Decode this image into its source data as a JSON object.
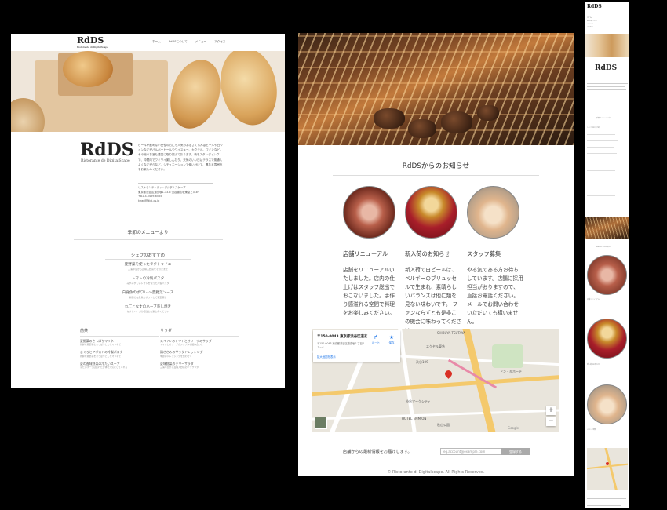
{
  "desktop": {
    "logo": "RdDS",
    "logo_sub": "Ristorante di DigitalScape",
    "nav": [
      "ホーム",
      "RdDSについて",
      "メニュー",
      "アクセス"
    ],
    "brand": "RdDS",
    "brand_sub": "Ristorante de DigitalScape",
    "intro": "ビールが飲めない女性の方にも人気のあるさくらんぼビールや白ワインなどがバルポーピールやワイスキー、カクテル、ワインなど、その他のお酒も豊富に取り揃えております。夜もスタンディングで、仲間内でワイワイ楽しんだり、天気のいい日はテラスで風通しよくなどがらなど、シチュエーションで使い分けて、異なる雰囲気をお楽しみください。",
    "address": [
      "リストランテ・ディ・デジタルスケープ",
      "東京都渋谷区道玄坂1-13-6 渋谷道玄坂東急ビル3F",
      "+81-3-5459-6535",
      "kirari@digi-cs.jp"
    ],
    "menu_heading": "季節のメニューより",
    "chef_heading": "シェフのおすすめ",
    "chef_items": [
      {
        "name": "夏野菜を使ったラタトゥイユ",
        "desc": "三浦半島から直輸入野菜をそのままで"
      },
      {
        "name": "トマトの冷製パスタ",
        "desc": "みずみずしいトマトを使った冷製パスタ"
      },
      {
        "name": "白身魚のポワレ 〜夏野菜ソース",
        "desc": "鮮度の白身魚をポワレして夏野菜を"
      },
      {
        "name": "丸ごとなすのハーブ蒸し焼き",
        "desc": "なすとハーブの相性をお楽しみください"
      }
    ],
    "zensai_heading": "前菜",
    "zensai_items": [
      {
        "name": "夏野菜のさっぱりマリネ",
        "desc": "新鮮な夏野菜をさっぱりとしたマリネで"
      },
      {
        "name": "まぐろとアボカドの冷製パスタ",
        "desc": "新鮮な夏野菜をさっぱりとしたマリネで"
      },
      {
        "name": "夏の香味野菜の冷たいスープ",
        "desc": "冷たいスープは疲れた身体を元気にしてくれる"
      }
    ],
    "salad_heading": "サラダ",
    "salad_items": [
      {
        "name": "スペインのトマトとオリーブのサラダ",
        "desc": "トマトとオリーブのシンプルな組み合わせ"
      },
      {
        "name": "鶏ささみのサラダドレッシング",
        "desc": "季節のドレッシングを合わせて"
      },
      {
        "name": "夏味野菜のデリーサラダ",
        "desc": "三浦半島から直輸入野菜のデリサラダ"
      }
    ]
  },
  "tablet": {
    "news_title": "RdDSからのお知らせ",
    "news": [
      {
        "title": "店舗リニューアル",
        "body": "店舗をリニューアルいたしました。店内の仕上げはスタッフ総出でおこないました。手作り感溢れる空間で料理をお楽しみください。"
      },
      {
        "title": "新入荷のお知らせ",
        "body": "新入荷の白ビールは、ベルギーのブリュッセルで生まれ、素晴らしいバランスは他に類を見ない味わいです。 ファンならずとも是非この機会に味わってください。"
      },
      {
        "title": "スタッフ募集",
        "body": "やる気のある方お待ちしています。店舗に採用担当がおりますので、直接お電話ください。メールでお問い合わせいただいても構いません。"
      }
    ],
    "map": {
      "place_title": "〒150-0043 東京都渋谷区道玄...",
      "place_address": "〒150-0043 東京都渋谷区道玄坂１丁目１３−６",
      "route_label": "ルート",
      "save_label": "保存",
      "enlarge_link": "拡大地図を表示",
      "labels": [
        "SHIBUYA TSUTAYA",
        "エクセル東急",
        "渋谷109",
        "渋谷マークシティ",
        "ドン・キホーテ",
        "HOTEL EMMION",
        "秋山公園",
        "Google"
      ]
    },
    "subscribe_label": "店舗からの最新情報をお届けします。",
    "subscribe_placeholder": "eg.account@example.com",
    "subscribe_button": "登録する",
    "footer": "© Ristorante di Digitalscape. All Rights Reserved."
  },
  "mobile": {
    "logo": "RdDS",
    "brand": "RdDS",
    "menu_heading": "季節のメニューより",
    "chef_heading": "シェフのおすすめ",
    "news_title": "RdDSからのお知らせ",
    "news_titles": [
      "店舗リニューアル",
      "新入荷のお知らせ",
      "スタッフ募集"
    ]
  }
}
